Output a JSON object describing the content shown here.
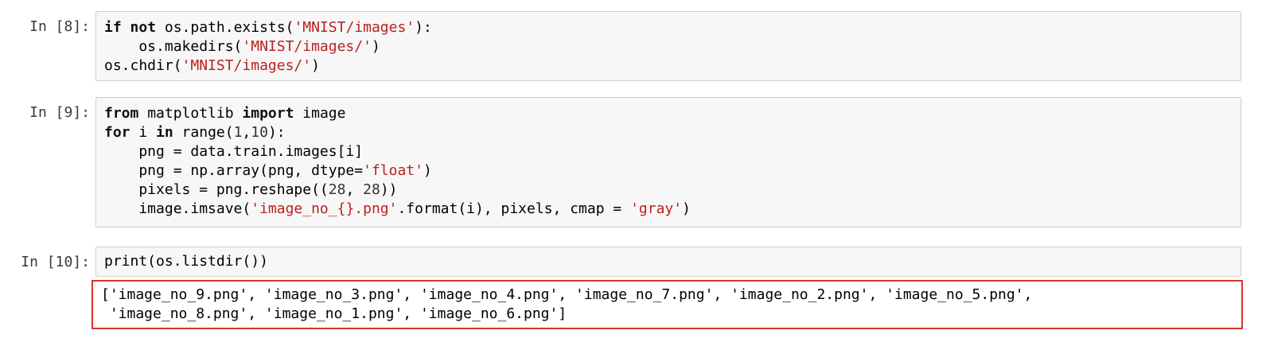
{
  "notebook": {
    "cells": [
      {
        "prompt": "In [8]:",
        "lines": [
          [
            {
              "t": "if",
              "c": "kw"
            },
            {
              "t": " "
            },
            {
              "t": "not",
              "c": "kw"
            },
            {
              "t": " os.path.exists("
            },
            {
              "t": "'MNIST/images'",
              "c": "str"
            },
            {
              "t": "):"
            }
          ],
          [
            {
              "t": "    os.makedirs("
            },
            {
              "t": "'MNIST/images/'",
              "c": "str"
            },
            {
              "t": ")"
            }
          ],
          [
            {
              "t": "os.chdir("
            },
            {
              "t": "'MNIST/images/'",
              "c": "str"
            },
            {
              "t": ")"
            }
          ]
        ]
      },
      {
        "prompt": "In [9]:",
        "lines": [
          [
            {
              "t": "from",
              "c": "kw"
            },
            {
              "t": " matplotlib "
            },
            {
              "t": "import",
              "c": "kw"
            },
            {
              "t": " image"
            }
          ],
          [
            {
              "t": "for",
              "c": "kw"
            },
            {
              "t": " i "
            },
            {
              "t": "in",
              "c": "kw"
            },
            {
              "t": " range("
            },
            {
              "t": "1",
              "c": "num"
            },
            {
              "t": ","
            },
            {
              "t": "10",
              "c": "num"
            },
            {
              "t": "):"
            }
          ],
          [
            {
              "t": "    png = data.train.images[i]"
            }
          ],
          [
            {
              "t": "    png = np.array(png, dtype="
            },
            {
              "t": "'float'",
              "c": "str"
            },
            {
              "t": ")"
            }
          ],
          [
            {
              "t": "    pixels = png.reshape(("
            },
            {
              "t": "28",
              "c": "num"
            },
            {
              "t": ", "
            },
            {
              "t": "28",
              "c": "num"
            },
            {
              "t": "))"
            }
          ],
          [
            {
              "t": "    image.imsave("
            },
            {
              "t": "'image_no_{}.png'",
              "c": "str"
            },
            {
              "t": ".format(i), pixels, cmap = "
            },
            {
              "t": "'gray'",
              "c": "str"
            },
            {
              "t": ")"
            }
          ]
        ]
      },
      {
        "prompt": "In [10]:",
        "lines": [
          [
            {
              "t": "print(os.listdir())"
            }
          ]
        ],
        "output": [
          "['image_no_9.png', 'image_no_3.png', 'image_no_4.png', 'image_no_7.png', 'image_no_2.png', 'image_no_5.png',",
          " 'image_no_8.png', 'image_no_1.png', 'image_no_6.png']"
        ]
      }
    ]
  }
}
